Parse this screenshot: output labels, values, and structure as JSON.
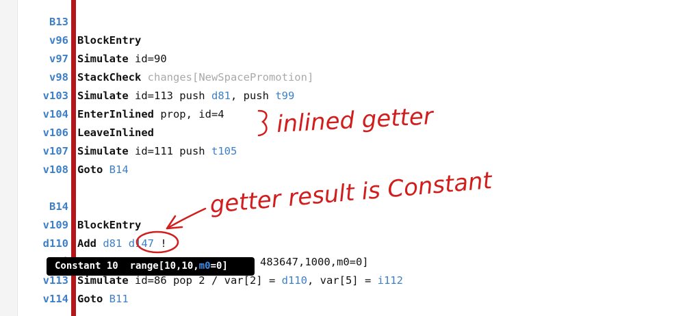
{
  "block_b13": {
    "label": "B13",
    "rows": [
      {
        "id": "v96",
        "op": "BlockEntry"
      },
      {
        "id": "v97",
        "op": "Simulate",
        "text": " id=90"
      },
      {
        "id": "v98",
        "op": "StackCheck",
        "extra": " changes[NewSpacePromotion]"
      },
      {
        "id": "v103",
        "op": "Simulate",
        "text": " id=113 push ",
        "ref1": "d81",
        "text2": ", push ",
        "ref2": "t99"
      },
      {
        "id": "v104",
        "op": "EnterInlined",
        "text": " prop, id=4"
      },
      {
        "id": "v106",
        "op": "LeaveInlined"
      },
      {
        "id": "v107",
        "op": "Simulate",
        "text": " id=111 push ",
        "ref1": "t105"
      },
      {
        "id": "v108",
        "op": "Goto",
        "ref1": "B14"
      }
    ]
  },
  "block_b14": {
    "label": "B14",
    "rows": [
      {
        "id": "v109",
        "op": "BlockEntry"
      },
      {
        "id": "d110",
        "op": "Add",
        "ref1": "d81",
        "ref2": "d147",
        "text3": " !"
      },
      {
        "id": "i",
        "text": "483647,1000,m0=0]"
      },
      {
        "id": "v113",
        "op": "Simulate",
        "text": " id=86 pop 2 / var[2] = ",
        "ref1": "d110",
        "text2": ", var[5] = ",
        "ref2": "i112"
      },
      {
        "id": "v114",
        "op": "Goto",
        "ref1": "B11"
      }
    ]
  },
  "tooltip": {
    "kind": "Constant 10",
    "range_prefix": "range[10,10,",
    "m0": "m0",
    "range_suffix": "=0]"
  },
  "annotations": {
    "inlined": "inlined getter",
    "constant": "getter result is Constant"
  },
  "colors": {
    "accent_blue": "#3d7fc7",
    "red_bar": "#b3161b",
    "ink": "#d21d1d"
  }
}
